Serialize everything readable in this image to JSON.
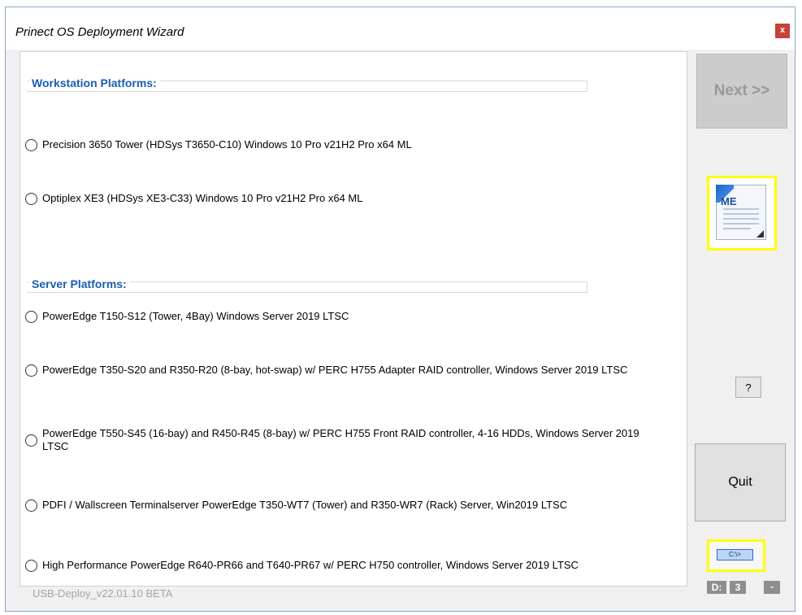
{
  "window": {
    "title": "Prinect OS Deployment Wizard",
    "close_label": "x"
  },
  "sections": {
    "workstation": {
      "label": "Workstation Platforms:",
      "options": [
        "Precision 3650 Tower (HDSys T3650-C10) Windows 10 Pro v21H2 Pro x64 ML",
        "Optiplex XE3 (HDSys XE3-C33) Windows 10 Pro v21H2 Pro x64 ML"
      ]
    },
    "server": {
      "label": "Server Platforms:",
      "options": [
        "PowerEdge T150-S12 (Tower, 4Bay) Windows Server 2019 LTSC",
        "PowerEdge T350-S20 and R350-R20 (8-bay, hot-swap) w/ PERC H755 Adapter RAID controller, Windows Server 2019 LTSC",
        "PowerEdge T550-S45 (16-bay) and R450-R45 (8-bay) w/ PERC H755 Front RAID controller, 4-16 HDDs, Windows Server 2019 LTSC",
        "PDFI / Wallscreen Terminalserver PowerEdge T350-WT7 (Tower) and R350-WR7 (Rack) Server, Win2019 LTSC",
        "High Performance PowerEdge R640-PR66 and T640-PR67 w/ PERC H750 controller,  Windows Server 2019 LTSC"
      ]
    }
  },
  "buttons": {
    "next": "Next >>",
    "help": "?",
    "quit": "Quit",
    "cmd": "C:\\>",
    "readme_icon_text": "ME",
    "minus": "-"
  },
  "status": {
    "version": "USB-Deploy_v22.01.10 BETA",
    "drive_letter": "D:",
    "drive_count": "3"
  },
  "colors": {
    "highlight": "#ffff00",
    "section_label": "#1a5db4",
    "close_red": "#c7413a"
  }
}
